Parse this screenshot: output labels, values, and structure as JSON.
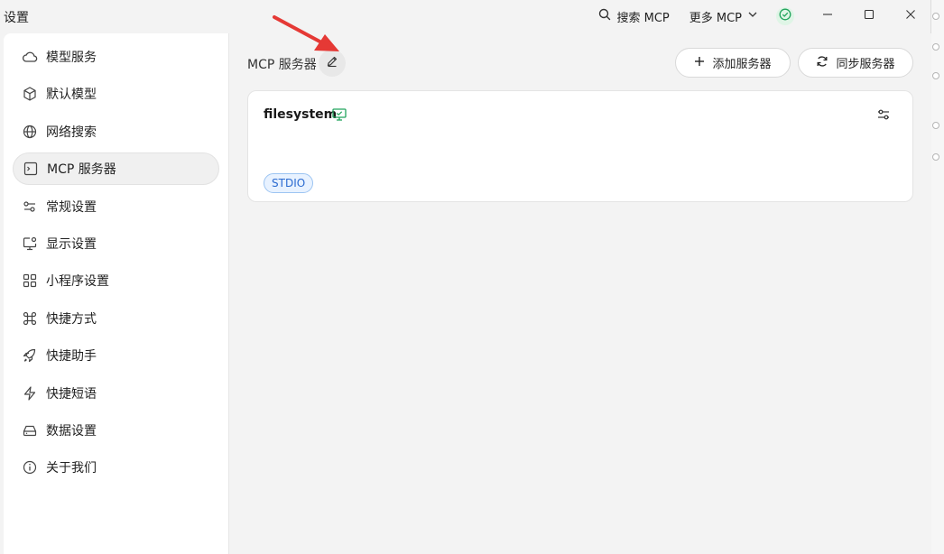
{
  "window": {
    "title": "设置"
  },
  "titlebar": {
    "search_label": "搜索 MCP",
    "more_label": "更多 MCP"
  },
  "sidebar": {
    "items": [
      {
        "label": "模型服务",
        "icon": "cloud-icon"
      },
      {
        "label": "默认模型",
        "icon": "cube-icon"
      },
      {
        "label": "网络搜索",
        "icon": "globe-icon"
      },
      {
        "label": "MCP 服务器",
        "icon": "terminal-icon",
        "active": true
      },
      {
        "label": "常规设置",
        "icon": "sliders-icon"
      },
      {
        "label": "显示设置",
        "icon": "monitor-settings-icon"
      },
      {
        "label": "小程序设置",
        "icon": "grid-icon"
      },
      {
        "label": "快捷方式",
        "icon": "command-icon"
      },
      {
        "label": "快捷助手",
        "icon": "rocket-icon"
      },
      {
        "label": "快捷短语",
        "icon": "lightning-icon"
      },
      {
        "label": "数据设置",
        "icon": "drive-icon"
      },
      {
        "label": "关于我们",
        "icon": "info-icon"
      }
    ]
  },
  "main": {
    "title": "MCP 服务器",
    "add_label": "添加服务器",
    "sync_label": "同步服务器",
    "servers": [
      {
        "name": "filesystem",
        "type": "STDIO"
      }
    ]
  },
  "colors": {
    "accent_green": "#22a45d",
    "badge_blue": "#2a6ad0",
    "annotation_red": "#e53935"
  }
}
